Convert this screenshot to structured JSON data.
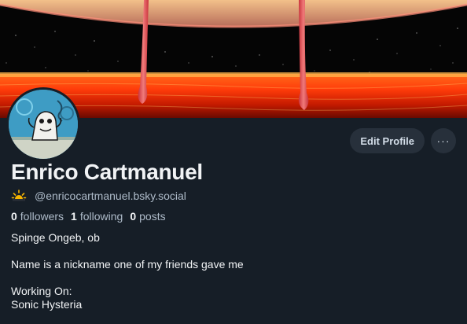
{
  "profile": {
    "display_name": "Enrico Cartmanuel",
    "handle": "@enricocartmanuel.bsky.social",
    "handle_icon": "sun-emoji-icon",
    "avatar_icon": "sponge-character-avatar",
    "banner_icon": "lava-planet-banner"
  },
  "actions": {
    "edit_profile_label": "Edit Profile",
    "more_label": "···"
  },
  "stats": {
    "followers_count": "0",
    "followers_label": "followers",
    "following_count": "1",
    "following_label": "following",
    "posts_count": "0",
    "posts_label": "posts"
  },
  "bio": {
    "line1": "Spinge Ongeb, ob",
    "line2": "Name is a nickname one of my friends gave me",
    "line3": "Working On:",
    "line4": "Sonic Hysteria"
  },
  "colors": {
    "background": "#161e27",
    "button_bg": "#27303b",
    "text_primary": "#f1f3f5",
    "text_secondary": "#aebbc9"
  }
}
